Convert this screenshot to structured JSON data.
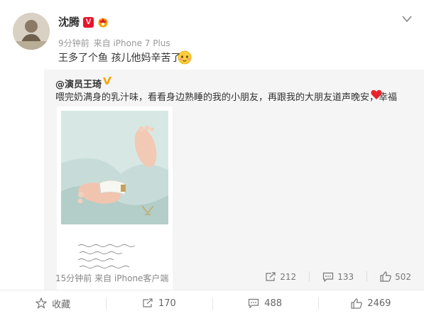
{
  "post": {
    "username": "沈腾",
    "verified_badge": "V",
    "time": "9分钟前",
    "source": "来自 iPhone 7 Plus",
    "text": "王多了个鱼 孩儿他妈辛苦了"
  },
  "repost": {
    "author": "@演员王琦",
    "text": "喂完奶满身的乳汁味，看看身边熟睡的我的小朋友，再跟我的大朋友道声晚安，幸福",
    "time": "15分钟前",
    "source": "来自 iPhone客户端",
    "actions": {
      "repost_count": "212",
      "comment_count": "133",
      "like_count": "502"
    }
  },
  "bottom_bar": {
    "favorite_label": "收藏",
    "repost_count": "170",
    "comment_count": "488",
    "like_count": "2469"
  },
  "icons": [
    "avatar",
    "verified-v-icon",
    "crown-badge-icon",
    "chevron-down-icon",
    "face-emoji-icon",
    "heart-emoji-icon",
    "star-icon",
    "repost-icon",
    "comment-icon",
    "like-icon"
  ],
  "colors": {
    "verified_red": "#e6162d",
    "heart_red": "#e8232d",
    "repost_bg": "#f5f5f5",
    "orange_badge": "#f7a400"
  }
}
